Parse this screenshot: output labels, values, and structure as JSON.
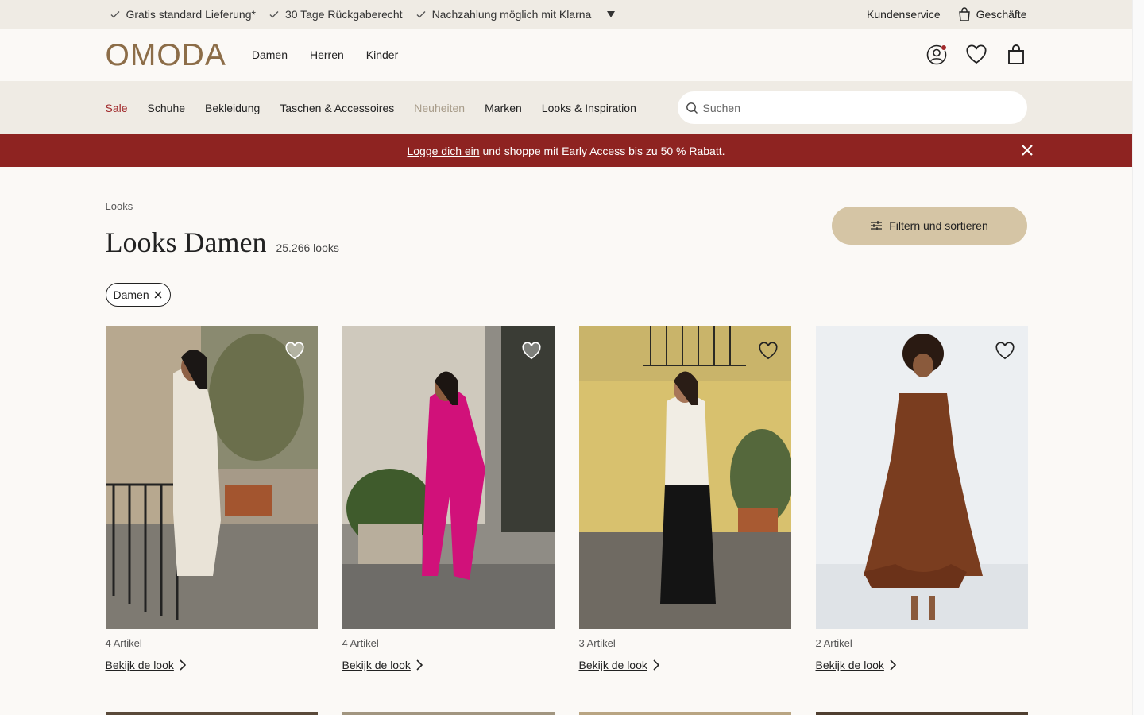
{
  "usp": {
    "items": [
      "Gratis standard Lieferung*",
      "30 Tage Rückgaberecht",
      "Nachzahlung möglich mit Klarna"
    ],
    "service": "Kundenservice",
    "stores": "Geschäfte"
  },
  "header": {
    "logo": "OMODA",
    "gender_nav": [
      "Damen",
      "Herren",
      "Kinder"
    ]
  },
  "catnav": {
    "items": [
      "Sale",
      "Schuhe",
      "Bekleidung",
      "Taschen & Accessoires",
      "Neuheiten",
      "Marken",
      "Looks & Inspiration"
    ],
    "search_placeholder": "Suchen"
  },
  "promo": {
    "link": "Logge dich ein",
    "text": " und shoppe mit Early Access bis zu ",
    "bold": "50 % Rabatt."
  },
  "main": {
    "breadcrumb": "Looks",
    "title": "Looks Damen",
    "count": "25.266 looks",
    "filter_label": "Filtern und sortieren",
    "chip": "Damen"
  },
  "looks": [
    {
      "items": "4 Artikel",
      "link": "Bekijk de look",
      "scene": "street-beige"
    },
    {
      "items": "4 Artikel",
      "link": "Bekijk de look",
      "scene": "street-pink"
    },
    {
      "items": "3 Artikel",
      "link": "Bekijk de look",
      "scene": "street-yellow"
    },
    {
      "items": "2 Artikel",
      "link": "Bekijk de look",
      "scene": "studio-brown"
    }
  ],
  "colors": {
    "accent_red": "#8e2321",
    "sale_red": "#a0282a",
    "logo_brown": "#8c6d48",
    "filter_beige": "#d5c5a5",
    "bar_bg": "#efebe4"
  }
}
